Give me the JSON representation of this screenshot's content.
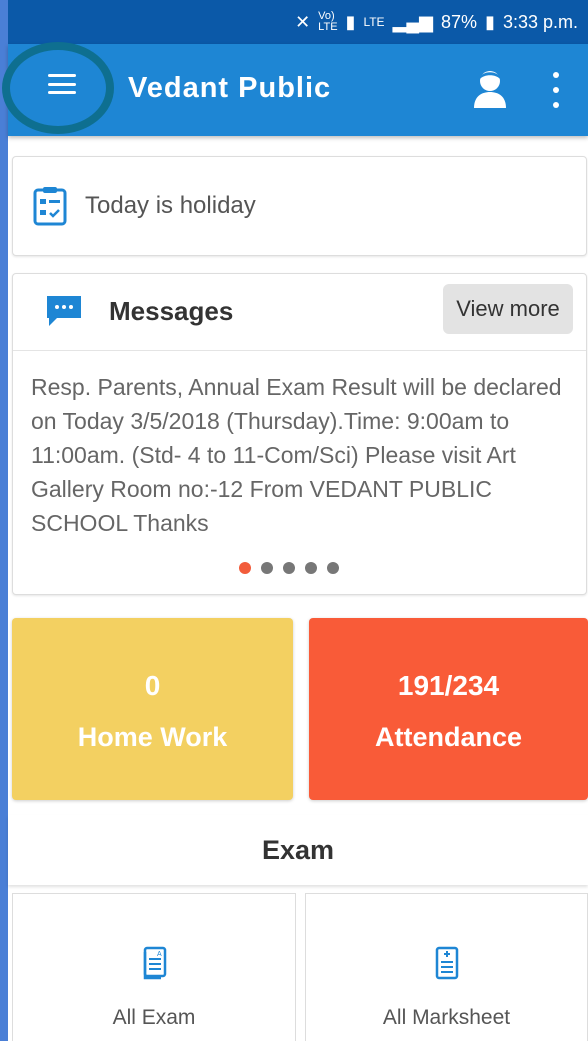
{
  "status_bar": {
    "network_text": "LTE",
    "battery": "87%",
    "time": "3:33 p.m."
  },
  "app_bar": {
    "title": "Vedant Public"
  },
  "holiday": {
    "text": "Today is holiday"
  },
  "messages": {
    "title": "Messages",
    "view_more_label": "View more",
    "body": "Resp. Parents, Annual Exam Result will be declared on Today 3/5/2018 (Thursday).Time: 9:00am to 11:00am. (Std- 4 to 11-Com/Sci) Please visit Art Gallery Room no:-12 From VEDANT PUBLIC SCHOOL Thanks",
    "page_count": 5,
    "active_page": 1
  },
  "stats": {
    "homework": {
      "value": "0",
      "label": "Home Work"
    },
    "attendance": {
      "value": "191/234",
      "label": "Attendance"
    }
  },
  "exam": {
    "title": "Exam",
    "tiles": [
      {
        "label": "All Exam",
        "icon": "exam-document-icon"
      },
      {
        "label": "All Marksheet",
        "icon": "marksheet-document-icon"
      }
    ]
  },
  "colors": {
    "status_bar": "#0b59a8",
    "app_bar": "#1e86d4",
    "homework_tile": "#f3d061",
    "attendance_tile": "#f95b38",
    "accent_dot": "#f25c3b",
    "icon_blue": "#1e86d4"
  }
}
